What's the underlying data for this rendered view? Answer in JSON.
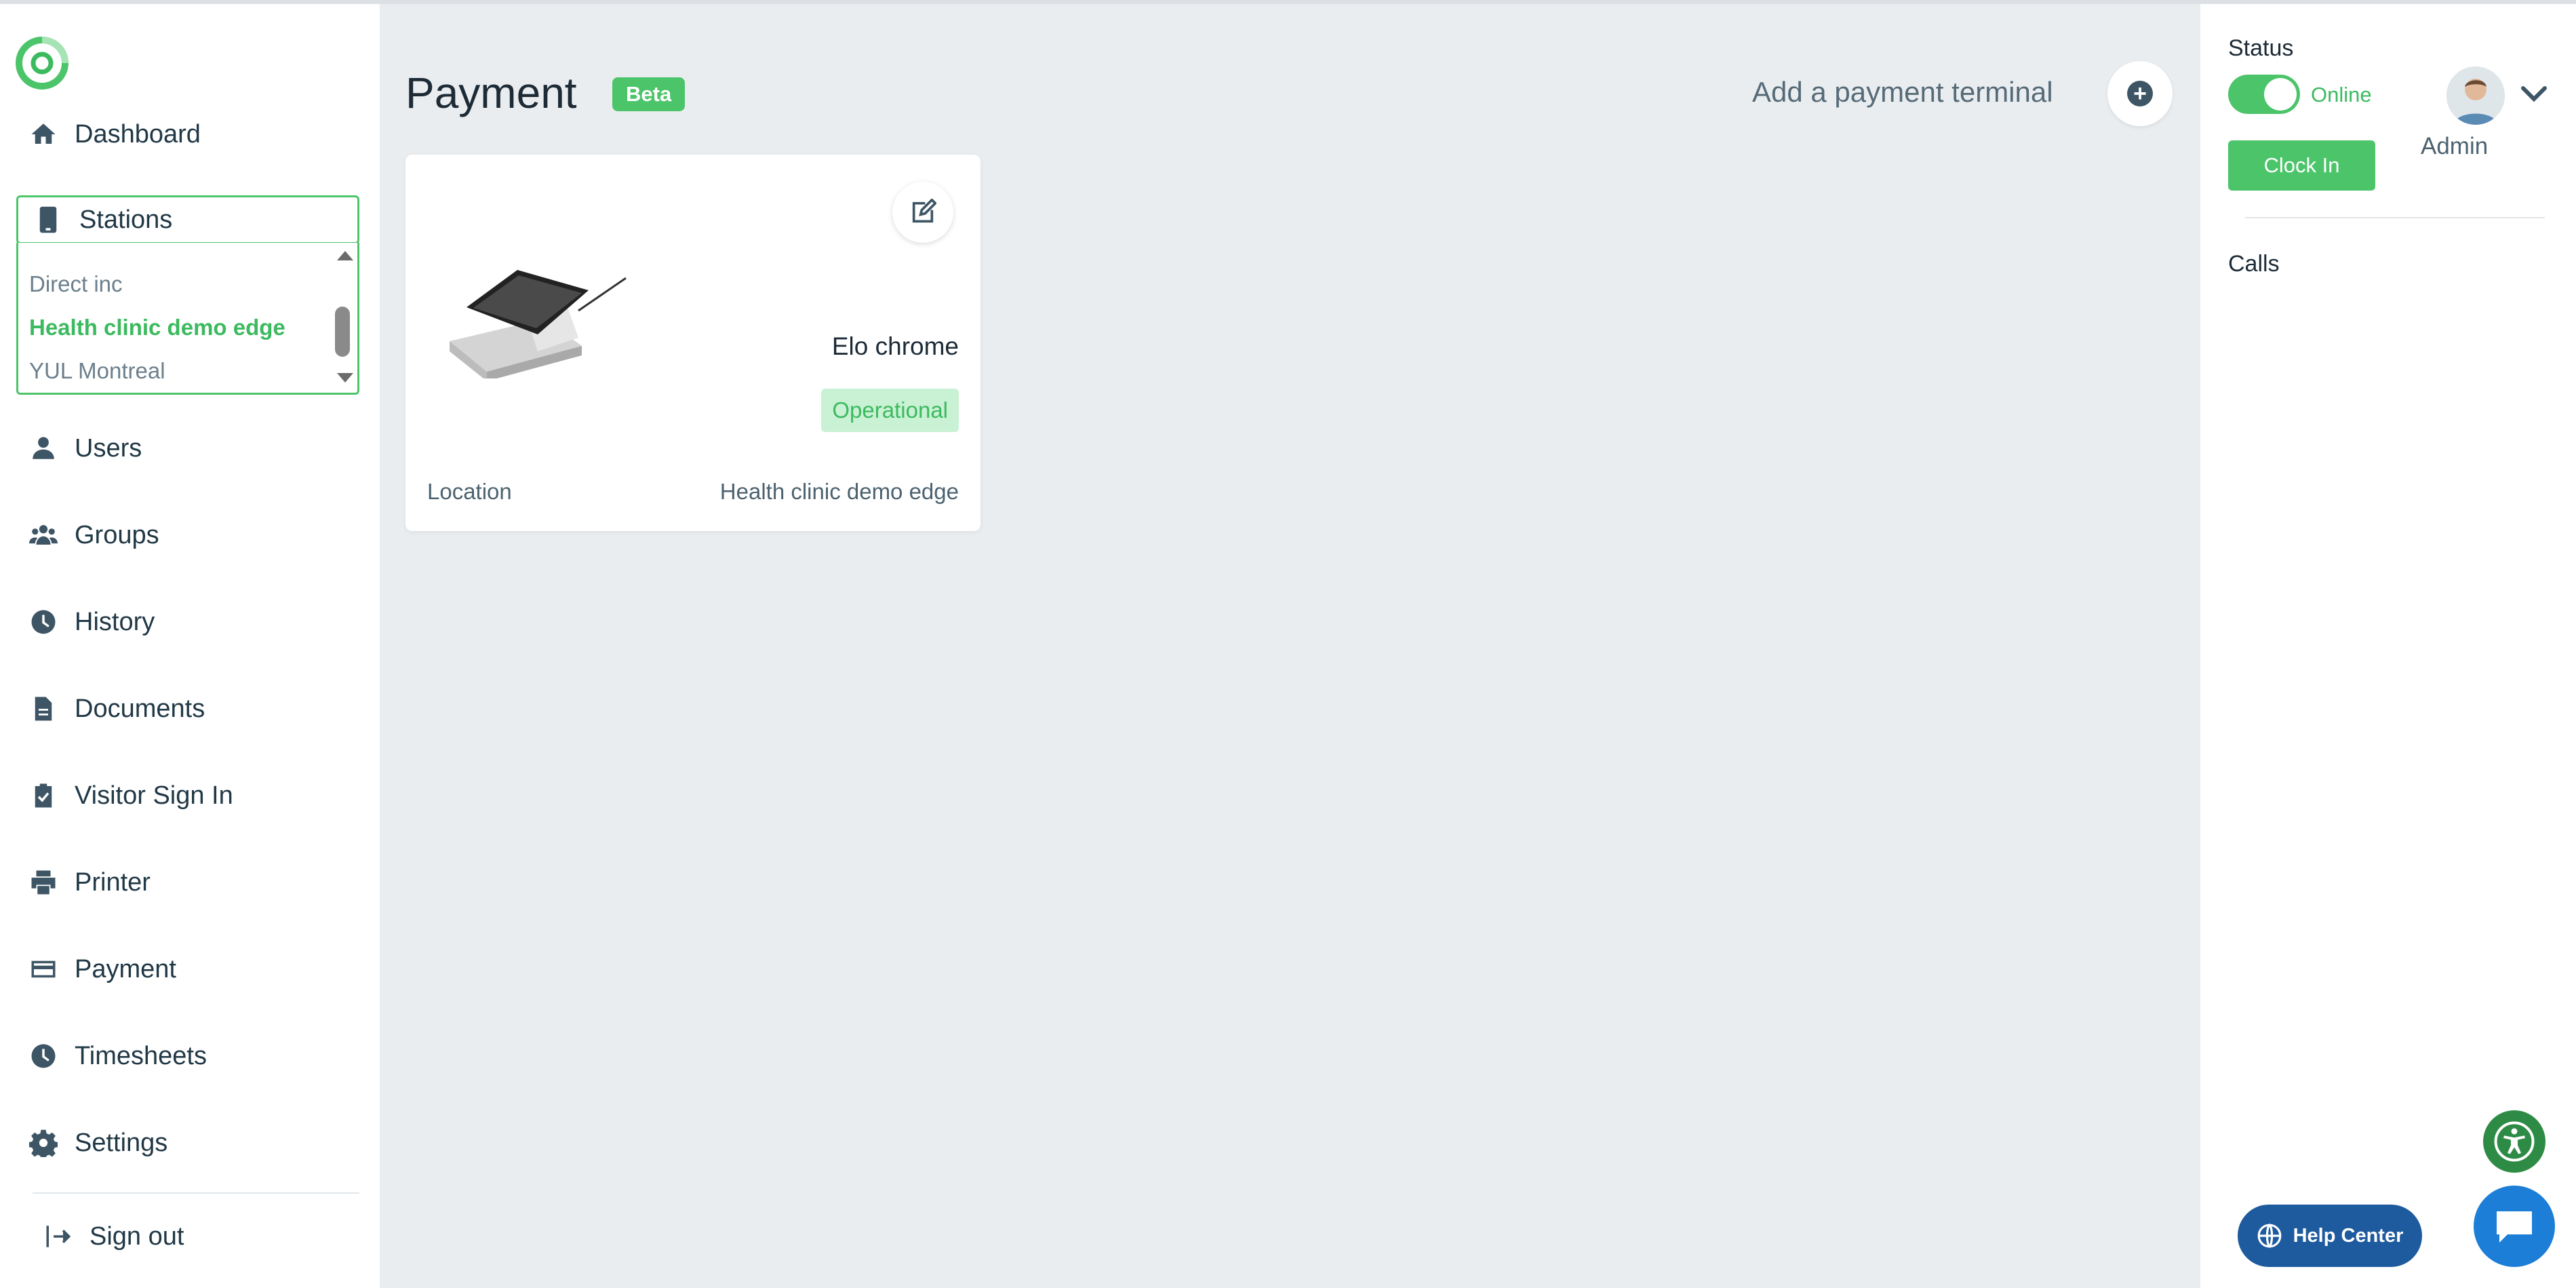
{
  "sidebar": {
    "items": [
      {
        "label": "Dashboard",
        "icon": "home-icon"
      },
      {
        "label": "Users",
        "icon": "user-icon"
      },
      {
        "label": "Groups",
        "icon": "groups-icon"
      },
      {
        "label": "History",
        "icon": "clock-icon"
      },
      {
        "label": "Documents",
        "icon": "document-icon"
      },
      {
        "label": "Visitor Sign In",
        "icon": "clipboard-check-icon"
      },
      {
        "label": "Printer",
        "icon": "printer-icon"
      },
      {
        "label": "Payment",
        "icon": "credit-card-icon"
      },
      {
        "label": "Timesheets",
        "icon": "clock-icon"
      },
      {
        "label": "Settings",
        "icon": "gear-icon"
      }
    ],
    "stations": {
      "label": "Stations",
      "options": [
        "Direct inc",
        "Health clinic demo edge",
        "YUL Montreal"
      ],
      "selected": "Health clinic demo edge"
    },
    "signout_label": "Sign out"
  },
  "main": {
    "title": "Payment",
    "badge": "Beta",
    "add_terminal_label": "Add a payment terminal",
    "terminal": {
      "name": "Elo chrome",
      "status": "Operational",
      "location_label": "Location",
      "location_value": "Health clinic demo edge"
    }
  },
  "right_panel": {
    "status_title": "Status",
    "online_label": "Online",
    "clock_in_label": "Clock In",
    "user_role": "Admin",
    "calls_title": "Calls"
  },
  "widgets": {
    "help_center_label": "Help Center"
  },
  "colors": {
    "accent_green": "#4cc46a",
    "help_blue": "#1e5a9e",
    "chat_blue": "#1c7ed6"
  }
}
